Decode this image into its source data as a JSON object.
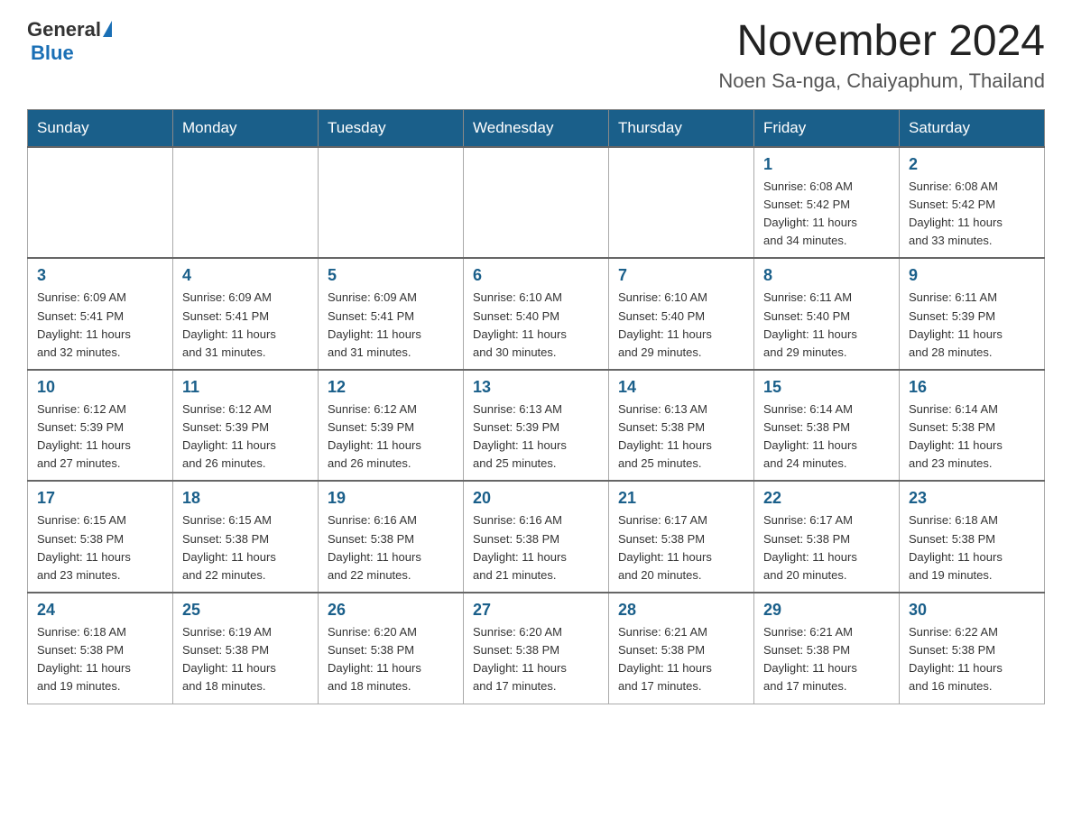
{
  "header": {
    "logo_general": "General",
    "logo_blue": "Blue",
    "month_title": "November 2024",
    "location": "Noen Sa-nga, Chaiyaphum, Thailand"
  },
  "weekdays": [
    "Sunday",
    "Monday",
    "Tuesday",
    "Wednesday",
    "Thursday",
    "Friday",
    "Saturday"
  ],
  "weeks": [
    [
      {
        "day": "",
        "info": ""
      },
      {
        "day": "",
        "info": ""
      },
      {
        "day": "",
        "info": ""
      },
      {
        "day": "",
        "info": ""
      },
      {
        "day": "",
        "info": ""
      },
      {
        "day": "1",
        "info": "Sunrise: 6:08 AM\nSunset: 5:42 PM\nDaylight: 11 hours\nand 34 minutes."
      },
      {
        "day": "2",
        "info": "Sunrise: 6:08 AM\nSunset: 5:42 PM\nDaylight: 11 hours\nand 33 minutes."
      }
    ],
    [
      {
        "day": "3",
        "info": "Sunrise: 6:09 AM\nSunset: 5:41 PM\nDaylight: 11 hours\nand 32 minutes."
      },
      {
        "day": "4",
        "info": "Sunrise: 6:09 AM\nSunset: 5:41 PM\nDaylight: 11 hours\nand 31 minutes."
      },
      {
        "day": "5",
        "info": "Sunrise: 6:09 AM\nSunset: 5:41 PM\nDaylight: 11 hours\nand 31 minutes."
      },
      {
        "day": "6",
        "info": "Sunrise: 6:10 AM\nSunset: 5:40 PM\nDaylight: 11 hours\nand 30 minutes."
      },
      {
        "day": "7",
        "info": "Sunrise: 6:10 AM\nSunset: 5:40 PM\nDaylight: 11 hours\nand 29 minutes."
      },
      {
        "day": "8",
        "info": "Sunrise: 6:11 AM\nSunset: 5:40 PM\nDaylight: 11 hours\nand 29 minutes."
      },
      {
        "day": "9",
        "info": "Sunrise: 6:11 AM\nSunset: 5:39 PM\nDaylight: 11 hours\nand 28 minutes."
      }
    ],
    [
      {
        "day": "10",
        "info": "Sunrise: 6:12 AM\nSunset: 5:39 PM\nDaylight: 11 hours\nand 27 minutes."
      },
      {
        "day": "11",
        "info": "Sunrise: 6:12 AM\nSunset: 5:39 PM\nDaylight: 11 hours\nand 26 minutes."
      },
      {
        "day": "12",
        "info": "Sunrise: 6:12 AM\nSunset: 5:39 PM\nDaylight: 11 hours\nand 26 minutes."
      },
      {
        "day": "13",
        "info": "Sunrise: 6:13 AM\nSunset: 5:39 PM\nDaylight: 11 hours\nand 25 minutes."
      },
      {
        "day": "14",
        "info": "Sunrise: 6:13 AM\nSunset: 5:38 PM\nDaylight: 11 hours\nand 25 minutes."
      },
      {
        "day": "15",
        "info": "Sunrise: 6:14 AM\nSunset: 5:38 PM\nDaylight: 11 hours\nand 24 minutes."
      },
      {
        "day": "16",
        "info": "Sunrise: 6:14 AM\nSunset: 5:38 PM\nDaylight: 11 hours\nand 23 minutes."
      }
    ],
    [
      {
        "day": "17",
        "info": "Sunrise: 6:15 AM\nSunset: 5:38 PM\nDaylight: 11 hours\nand 23 minutes."
      },
      {
        "day": "18",
        "info": "Sunrise: 6:15 AM\nSunset: 5:38 PM\nDaylight: 11 hours\nand 22 minutes."
      },
      {
        "day": "19",
        "info": "Sunrise: 6:16 AM\nSunset: 5:38 PM\nDaylight: 11 hours\nand 22 minutes."
      },
      {
        "day": "20",
        "info": "Sunrise: 6:16 AM\nSunset: 5:38 PM\nDaylight: 11 hours\nand 21 minutes."
      },
      {
        "day": "21",
        "info": "Sunrise: 6:17 AM\nSunset: 5:38 PM\nDaylight: 11 hours\nand 20 minutes."
      },
      {
        "day": "22",
        "info": "Sunrise: 6:17 AM\nSunset: 5:38 PM\nDaylight: 11 hours\nand 20 minutes."
      },
      {
        "day": "23",
        "info": "Sunrise: 6:18 AM\nSunset: 5:38 PM\nDaylight: 11 hours\nand 19 minutes."
      }
    ],
    [
      {
        "day": "24",
        "info": "Sunrise: 6:18 AM\nSunset: 5:38 PM\nDaylight: 11 hours\nand 19 minutes."
      },
      {
        "day": "25",
        "info": "Sunrise: 6:19 AM\nSunset: 5:38 PM\nDaylight: 11 hours\nand 18 minutes."
      },
      {
        "day": "26",
        "info": "Sunrise: 6:20 AM\nSunset: 5:38 PM\nDaylight: 11 hours\nand 18 minutes."
      },
      {
        "day": "27",
        "info": "Sunrise: 6:20 AM\nSunset: 5:38 PM\nDaylight: 11 hours\nand 17 minutes."
      },
      {
        "day": "28",
        "info": "Sunrise: 6:21 AM\nSunset: 5:38 PM\nDaylight: 11 hours\nand 17 minutes."
      },
      {
        "day": "29",
        "info": "Sunrise: 6:21 AM\nSunset: 5:38 PM\nDaylight: 11 hours\nand 17 minutes."
      },
      {
        "day": "30",
        "info": "Sunrise: 6:22 AM\nSunset: 5:38 PM\nDaylight: 11 hours\nand 16 minutes."
      }
    ]
  ]
}
